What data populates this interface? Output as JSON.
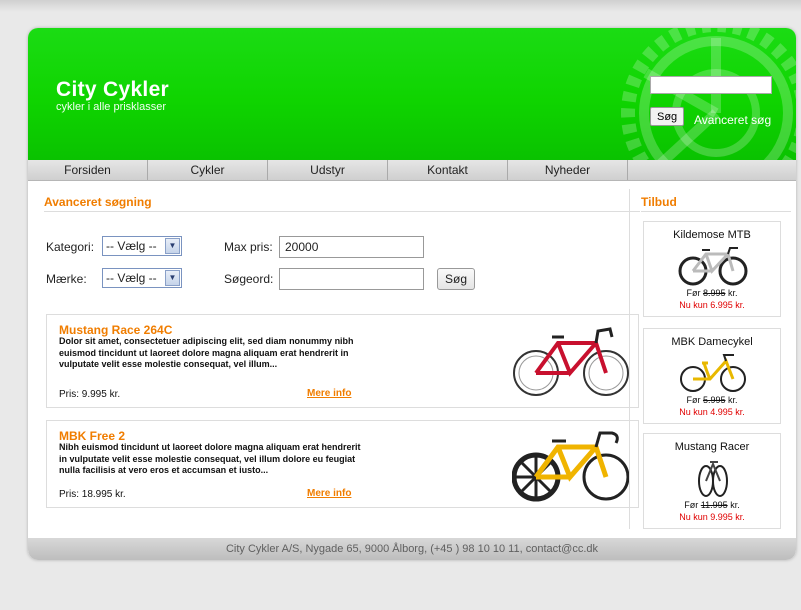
{
  "header": {
    "title": "City Cykler",
    "subtitle": "cykler i alle prisklasser",
    "search_button": "Søg",
    "advanced_link": "Avanceret søg"
  },
  "nav": [
    "Forsiden",
    "Cykler",
    "Udstyr",
    "Kontakt",
    "Nyheder"
  ],
  "search_form": {
    "heading": "Avanceret søgning",
    "category_label": "Kategori:",
    "category_value": "-- Vælg --",
    "brand_label": "Mærke:",
    "brand_value": "-- Vælg --",
    "maxprice_label": "Max pris:",
    "maxprice_value": "20000",
    "keyword_label": "Søgeord:",
    "keyword_value": "",
    "search_button": "Søg"
  },
  "products": [
    {
      "title": "Mustang Race 264C",
      "description": "Dolor sit amet, consectetuer adipiscing elit, sed diam nonummy nibh euismod tincidunt ut laoreet dolore magna aliquam erat hendrerit in vulputate velit esse molestie consequat, vel illum...",
      "price": "Pris: 9.995 kr.",
      "more": "Mere info",
      "colors": {
        "frame": "#c8102e",
        "accent": "#222222"
      }
    },
    {
      "title": "MBK Free 2",
      "description": "Nibh euismod tincidunt ut laoreet dolore magna aliquam erat hendrerit in vulputate velit esse molestie consequat, vel illum dolore eu feugiat nulla facilisis at vero eros et accumsan et iusto...",
      "price": "Pris: 18.995 kr.",
      "more": "Mere info",
      "colors": {
        "frame": "#f0b400",
        "accent": "#222222"
      }
    }
  ],
  "offers": {
    "heading": "Tilbud",
    "items": [
      {
        "name": "Kildemose MTB",
        "before_prefix": "Før",
        "before_price": "8.995",
        "before_suffix": "kr.",
        "now": "Nu kun 6.995 kr."
      },
      {
        "name": "MBK Damecykel",
        "before_prefix": "Før",
        "before_price": "5.995",
        "before_suffix": "kr.",
        "now": "Nu kun 4.995 kr."
      },
      {
        "name": "Mustang Racer",
        "before_prefix": "Før",
        "before_price": "11.995",
        "before_suffix": "kr.",
        "now": "Nu kun 9.995 kr."
      }
    ]
  },
  "footer": "City Cykler A/S, Nygade 65, 9000 Ålborg, (+45 ) 98 10 10 11, contact@cc.dk",
  "colors": {
    "brand_green": "#11d400",
    "accent_orange": "#f07d00",
    "price_red": "#e00000"
  }
}
